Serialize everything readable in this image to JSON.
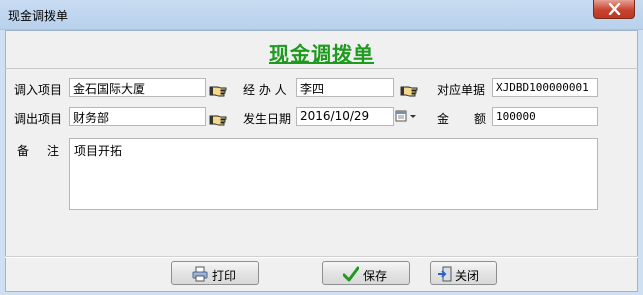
{
  "window": {
    "title": "现金调拨单"
  },
  "form": {
    "heading": "现金调拨单",
    "labels": {
      "in_project": "调入项目",
      "handler": "经 办 人",
      "ref_doc": "对应单据",
      "out_project": "调出项目",
      "date": "发生日期",
      "amount_a": "金",
      "amount_b": "额",
      "remark_a": "备",
      "remark_b": "注"
    },
    "values": {
      "in_project": "金石国际大厦",
      "handler": "李四",
      "ref_doc": "XJDBD100000001",
      "out_project": "财务部",
      "date": "2016/10/29",
      "amount": "100000",
      "remark": "项目开拓"
    }
  },
  "buttons": {
    "print": "打印",
    "save": "保存",
    "close": "关闭"
  },
  "icons": [
    "close-icon",
    "pointing-hand-icon",
    "calendar-icon",
    "chevron-down-icon",
    "printer-icon",
    "checkmark-icon",
    "exit-door-icon"
  ]
}
